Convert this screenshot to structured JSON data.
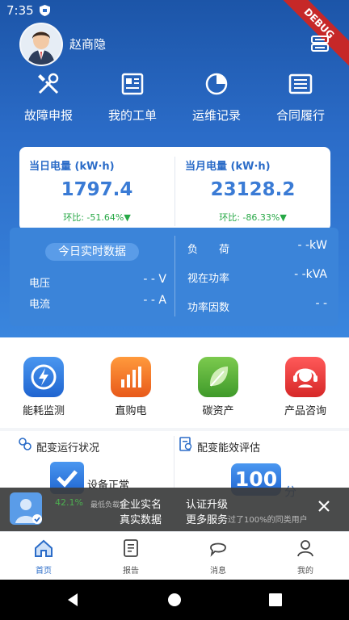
{
  "status_bar": {
    "time": "7:35",
    "debug_label": "DEBUG"
  },
  "header": {
    "username": "赵商隐"
  },
  "quick_actions": [
    {
      "label": "故障申报",
      "icon": "tools-icon"
    },
    {
      "label": "我的工单",
      "icon": "work-order-icon"
    },
    {
      "label": "运维记录",
      "icon": "pie-chart-icon"
    },
    {
      "label": "合同履行",
      "icon": "contract-list-icon"
    }
  ],
  "energy_card": {
    "daily": {
      "title": "当日电量 (kW·h)",
      "value": "1797.4",
      "ratio": "环比: -51.64%▼"
    },
    "monthly": {
      "title": "当月电量 (kW·h)",
      "value": "23128.2",
      "ratio": "环比: -86.33%▼"
    }
  },
  "realtime": {
    "title": "今日实时数据",
    "voltage_label": "电压",
    "voltage_value": "- - V",
    "current_label": "电流",
    "current_value": "- - A",
    "load_label": "负　　荷",
    "load_value": "- -kW",
    "apparent_label": "视在功率",
    "apparent_value": "- -kVA",
    "pf_label": "功率因数",
    "pf_value": "- -"
  },
  "services": [
    {
      "label": "能耗监测",
      "icon": "lightning-icon",
      "color": "#2d7be5"
    },
    {
      "label": "直购电",
      "icon": "bar-chart-icon",
      "color": "#f07a1e"
    },
    {
      "label": "碳资产",
      "icon": "leaf-icon",
      "color": "#57b33b"
    },
    {
      "label": "产品咨询",
      "icon": "headset-icon",
      "color": "#e83b3b"
    }
  ],
  "sections": {
    "left_title": "配变运行状况",
    "right_title": "配变能效评估",
    "device_status": "设备正常",
    "load_percent": "42.1%",
    "load_caption": "最低负载率",
    "score": "100",
    "score_unit": "分",
    "score_caption": "过了100%的同类用户"
  },
  "banner": {
    "line1a": "企业实名",
    "line1b": "真实数据",
    "line2a": "认证升级",
    "line2b": "更多服务"
  },
  "bottom_nav": [
    {
      "label": "首页",
      "icon": "home-icon",
      "active": true
    },
    {
      "label": "报告",
      "icon": "report-icon",
      "active": false
    },
    {
      "label": "消息",
      "icon": "message-icon",
      "active": false
    },
    {
      "label": "我的",
      "icon": "profile-icon",
      "active": false
    }
  ]
}
